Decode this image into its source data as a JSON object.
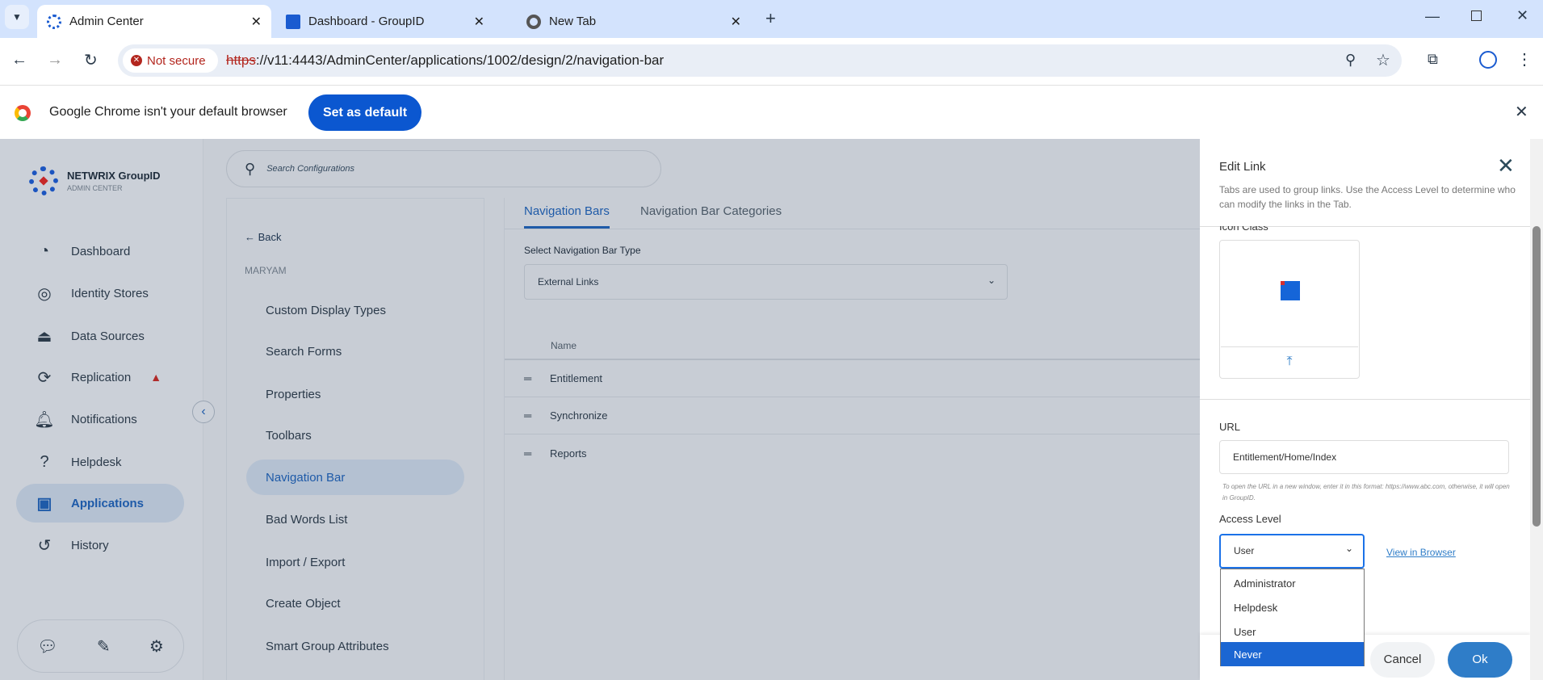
{
  "browser": {
    "tabs": [
      {
        "title": "Admin Center",
        "active": true
      },
      {
        "title": "Dashboard - GroupID"
      },
      {
        "title": "New Tab"
      }
    ],
    "not_secure": "Not secure",
    "url_scheme": "https",
    "url_rest": "://v11:4443/AdminCenter/applications/1002/design/2/navigation-bar",
    "infobar_text": "Google Chrome isn't your default browser",
    "set_default": "Set as default"
  },
  "brand": {
    "name": "NETWRIX GroupID",
    "sub": "ADMIN CENTER"
  },
  "search": {
    "placeholder": "Search Configurations"
  },
  "sidebar": {
    "items": [
      {
        "label": "Dashboard",
        "icon": "dashboard-icon"
      },
      {
        "label": "Identity Stores",
        "icon": "identity-icon"
      },
      {
        "label": "Data Sources",
        "icon": "data-source-icon"
      },
      {
        "label": "Replication",
        "icon": "replication-icon",
        "warning": true
      },
      {
        "label": "Notifications",
        "icon": "bell-icon"
      },
      {
        "label": "Helpdesk",
        "icon": "helpdesk-icon"
      },
      {
        "label": "Applications",
        "icon": "applications-icon",
        "active": true
      },
      {
        "label": "History",
        "icon": "history-icon"
      }
    ]
  },
  "subnav": {
    "back": "Back",
    "section": "MARYAM",
    "items": [
      "Custom Display Types",
      "Search Forms",
      "Properties",
      "Toolbars",
      "Navigation Bar",
      "Bad Words List",
      "Import / Export",
      "Create Object",
      "Smart Group Attributes"
    ],
    "active": "Navigation Bar"
  },
  "main": {
    "tabs": [
      "Navigation Bars",
      "Navigation Bar Categories"
    ],
    "select_label": "Select Navigation Bar Type",
    "select_value": "External Links",
    "column": "Name",
    "rows": [
      "Entitlement",
      "Synchronize",
      "Reports"
    ]
  },
  "edit": {
    "title": "Edit Link",
    "desc": "Tabs are used to group links. Use the Access Level to determine who can modify the links in the Tab.",
    "icon_class": "Icon Class",
    "url_label": "URL",
    "url_value": "Entitlement/Home/Index",
    "url_help": "To open the URL in a new window, enter it in this format: https://www.abc.com, otherwise, it will open in GroupID.",
    "access_label": "Access Level",
    "access_value": "User",
    "view_browser": "View in Browser",
    "options": [
      "Administrator",
      "Helpdesk",
      "User",
      "Never"
    ],
    "highlighted": "Never",
    "cancel": "Cancel",
    "ok": "Ok"
  },
  "colors": {
    "accent": "#1e5aa8",
    "ok": "#2f7dc8",
    "highlight": "#1b66d2"
  }
}
